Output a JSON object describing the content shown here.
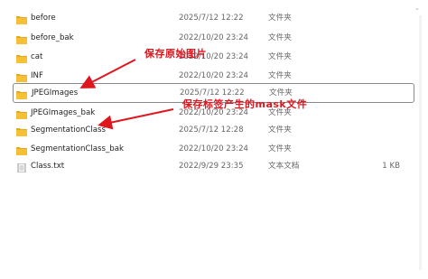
{
  "top_arrow": "⌄",
  "files": [
    {
      "name": "before",
      "date": "2025/7/12 12:22",
      "type": "文件夹",
      "size": "",
      "icon": "folder-icon",
      "selected": false
    },
    {
      "name": "before_bak",
      "date": "2022/10/20 23:24",
      "type": "文件夹",
      "size": "",
      "icon": "folder-icon",
      "selected": false
    },
    {
      "name": "cat",
      "date": "2022/10/20 23:24",
      "type": "文件夹",
      "size": "",
      "icon": "folder-icon",
      "selected": false
    },
    {
      "name": "INF",
      "date": "2022/10/20 23:24",
      "type": "文件夹",
      "size": "",
      "icon": "folder-icon",
      "selected": false
    },
    {
      "name": "JPEGImages",
      "date": "2025/7/12 12:22",
      "type": "文件夹",
      "size": "",
      "icon": "folder-icon",
      "selected": true
    },
    {
      "name": "JPEGImages_bak",
      "date": "2022/10/20 23:24",
      "type": "文件夹",
      "size": "",
      "icon": "folder-icon",
      "selected": false
    },
    {
      "name": "SegmentationClass",
      "date": "2025/7/12 12:28",
      "type": "文件夹",
      "size": "",
      "icon": "folder-icon",
      "selected": false
    },
    {
      "name": "SegmentationClass_bak",
      "date": "2022/10/20 23:24",
      "type": "文件夹",
      "size": "",
      "icon": "folder-icon",
      "selected": false
    },
    {
      "name": "Class.txt",
      "date": "2022/9/29 23:35",
      "type": "文本文档",
      "size": "1 KB",
      "icon": "text-file-icon",
      "selected": false
    }
  ],
  "annotations": {
    "original_images": "保存原始图片",
    "mask_files": "保存标签产生的mask文件"
  },
  "colors": {
    "annotation": "#e0161f",
    "folder": "#f5c035",
    "selected_border": "#8a8a8a"
  }
}
